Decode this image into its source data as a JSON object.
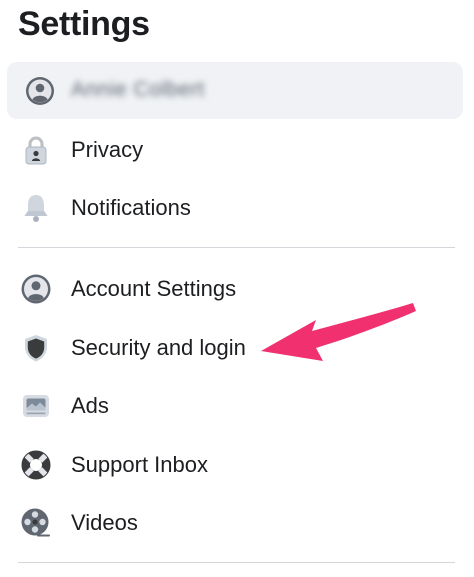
{
  "header": {
    "title": "Settings"
  },
  "profile": {
    "name": "Annie Colbert",
    "icon": "user-circle-icon"
  },
  "sections": [
    {
      "items": [
        {
          "label": "Privacy",
          "icon": "lock-icon"
        },
        {
          "label": "Notifications",
          "icon": "bell-icon"
        }
      ]
    },
    {
      "items": [
        {
          "label": "Account Settings",
          "icon": "user-circle-icon"
        },
        {
          "label": "Security and login",
          "icon": "shield-icon"
        },
        {
          "label": "Ads",
          "icon": "ads-icon"
        },
        {
          "label": "Support Inbox",
          "icon": "lifebuoy-icon"
        },
        {
          "label": "Videos",
          "icon": "film-reel-icon"
        }
      ]
    }
  ],
  "annotation": {
    "type": "arrow",
    "color": "#f0306f",
    "points_to": "Security and login"
  },
  "colors": {
    "card_bg": "#f0f2f5",
    "text": "#1c1e21",
    "icon_gray": "#606770",
    "divider": "#d3d6da"
  }
}
